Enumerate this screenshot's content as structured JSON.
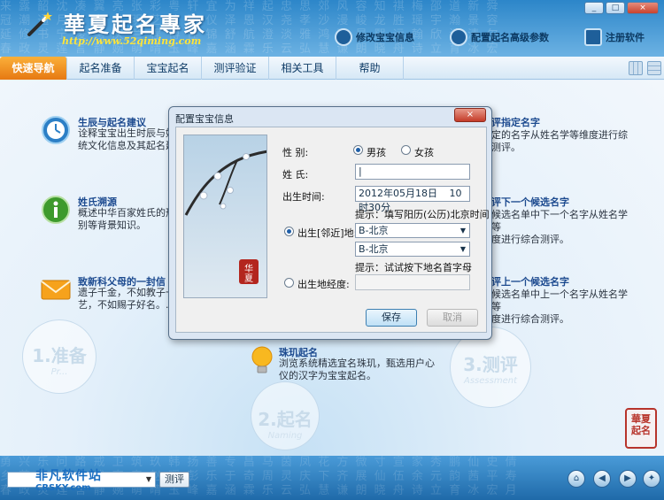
{
  "app": {
    "title": "華夏起名專家",
    "url": "http://www.52qiming.com",
    "header_links": [
      "修改宝宝信息",
      "配置起名高级参数",
      "注册软件"
    ],
    "window_controls": [
      "_",
      "□",
      "×"
    ]
  },
  "nav": {
    "tabs": [
      "快速导航",
      "起名准备",
      "宝宝起名",
      "测评验证",
      "相关工具",
      "帮助"
    ],
    "active": "快速导航"
  },
  "features_left": [
    {
      "title": "生辰与起名建议",
      "desc": "诠释宝宝出生时辰与姓",
      "desc2": "统文化信息及其起名建"
    },
    {
      "title": "姓氏溯源",
      "desc": "概述中华百家姓氏的形",
      "desc2": "别等背景知识。"
    },
    {
      "title": "致新科父母的一封信",
      "desc": "遗子千金，不如教子一",
      "desc2": "艺，不如赐子好名。.."
    }
  ],
  "features_right": [
    {
      "title": "评指定名字",
      "desc": "定的名字从姓名学等维度进行综",
      "desc2": "测评。"
    },
    {
      "title": "评下一个候选名字",
      "desc": "候选名单中下一个名字从姓名学等",
      "desc2": "度进行综合测评。"
    },
    {
      "title": "评上一个候选名字",
      "desc": "候选名单中上一个名字从姓名学等",
      "desc2": "度进行综合测评。"
    }
  ],
  "feature_center": {
    "title": "珠玑起名",
    "desc": "浏览系统精选宜名珠玑，甄选用户心",
    "desc2": "仪的汉字为宝宝起名。"
  },
  "steps": [
    {
      "label": "1.准备",
      "sub": "Pr..."
    },
    {
      "label": "2.起名",
      "sub": "Naming"
    },
    {
      "label": "3.测评",
      "sub": "Assessment"
    }
  ],
  "seal_text": "華夏起名",
  "bottom": {
    "search_placeholder": "",
    "test_button": "测评",
    "watermark": "非凡软件站",
    "watermark_en": "CRSKY.com"
  },
  "dialog": {
    "title": "配置宝宝信息",
    "close": "×",
    "gender_label": "性    别:",
    "gender_options": [
      "男孩",
      "女孩"
    ],
    "gender_selected": "男孩",
    "surname_label": "姓    氏:",
    "surname_value": "|",
    "birthtime_label": "出生时间:",
    "birth_date": "2012年05月18日",
    "birth_time": "10时30分",
    "hint_time": "提示：填写阳历(公历)北京时间",
    "birthplace_label": "出生[邻近]地:",
    "province": "B-北京",
    "city": "B-北京",
    "hint_place": "提示：试试按下地名首字母",
    "longitude_label": "出生地经度:",
    "longitude_value": "",
    "save_button": "保存",
    "cancel_button": "取消",
    "pic_caption": "华夏"
  }
}
